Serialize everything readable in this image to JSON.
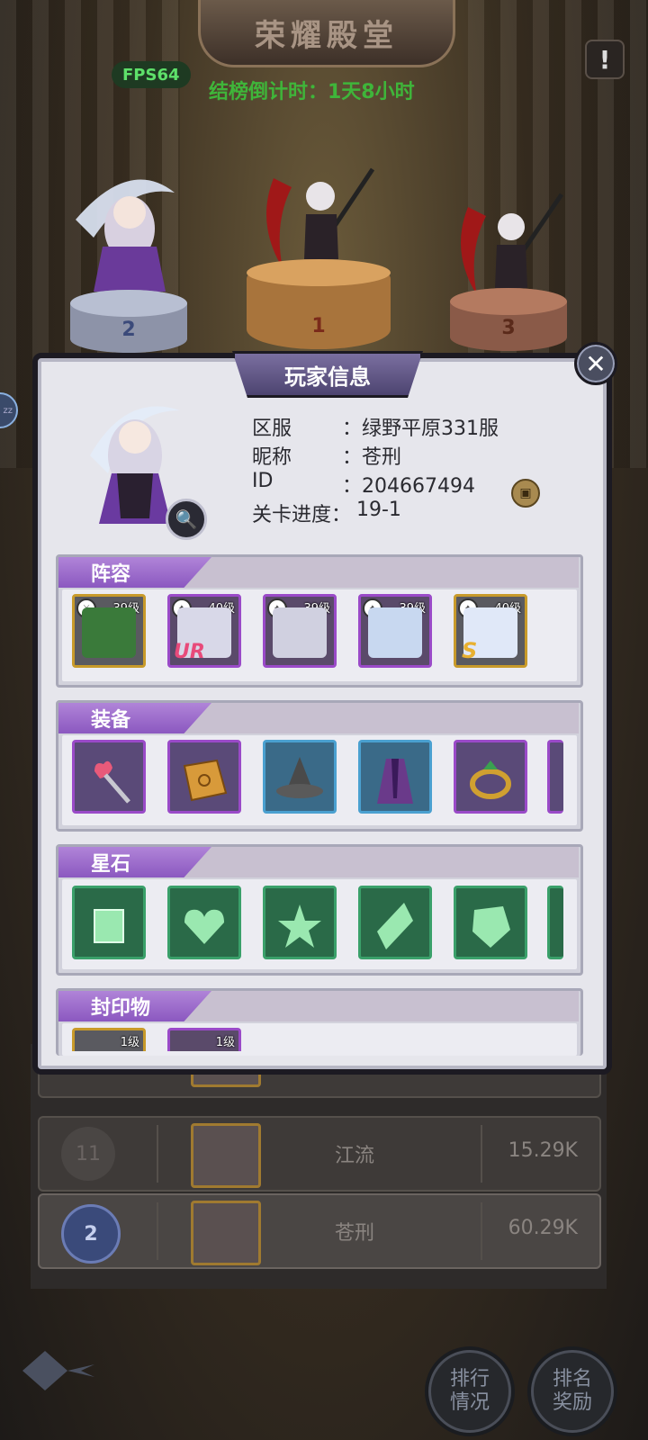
{
  "header": {
    "title": "荣耀殿堂",
    "fps": "FPS64",
    "countdown": "结榜倒计时：1天8小时",
    "info_icon": "!"
  },
  "podiums": [
    {
      "rank": "2"
    },
    {
      "rank": "1"
    },
    {
      "rank": "3"
    }
  ],
  "side_bubble": "zz",
  "modal": {
    "title": "玩家信息",
    "close_icon": "✕",
    "magnify_icon": "🔍",
    "info": [
      {
        "key": "区服",
        "value": "：绿野平原331服"
      },
      {
        "key": "昵称",
        "value": "：苍刑"
      },
      {
        "key": "ID",
        "value": "：204667494"
      },
      {
        "key": "关卡进度：",
        "value": "19-1"
      }
    ],
    "copy_icon": "▣",
    "sections": {
      "lineup": {
        "title": "阵容",
        "heroes": [
          {
            "level": "39级",
            "frame": "gold",
            "color": "#3a7a3a"
          },
          {
            "level": "40级",
            "frame": "purple",
            "color": "#d8d8e8",
            "tag": "UR"
          },
          {
            "level": "39级",
            "frame": "purple",
            "color": "#d0d0e0"
          },
          {
            "level": "39级",
            "frame": "purple",
            "color": "#c8d8f0"
          },
          {
            "level": "40级",
            "frame": "gold",
            "color": "#e0e8f8",
            "tag": "S"
          }
        ]
      },
      "equipment": {
        "title": "装备",
        "items": [
          {
            "name": "staff-icon",
            "frame": "purple",
            "color": "#e85a7a"
          },
          {
            "name": "book-icon",
            "frame": "purple",
            "color": "#d89a3a"
          },
          {
            "name": "hat-icon",
            "frame": "blue",
            "color": "#5a5a5a"
          },
          {
            "name": "robe-icon",
            "frame": "blue",
            "color": "#6a3a8a"
          },
          {
            "name": "ring-icon",
            "frame": "purple",
            "color": "#d0a030"
          }
        ]
      },
      "starstone": {
        "title": "星石",
        "gems": [
          {
            "name": "square-gem-icon"
          },
          {
            "name": "heart-gem-icon"
          },
          {
            "name": "star-gem-icon"
          },
          {
            "name": "diamond-gem-icon"
          },
          {
            "name": "round-gem-icon"
          }
        ]
      },
      "seal": {
        "title": "封印物",
        "items": [
          {
            "level": "1级"
          },
          {
            "level": "1级"
          }
        ]
      }
    }
  },
  "rank_list": [
    {
      "rank": "11",
      "name": "江流",
      "score": "15.29K"
    },
    {
      "rank": "2",
      "name": "苍刑",
      "score": "60.29K"
    }
  ],
  "bottom_nav": {
    "ranking_label": "排行\n情况",
    "reward_label": "排名\n奖励"
  },
  "colors": {
    "accent_purple": "#8b58c0",
    "gem_green": "#3aa06a",
    "gold_frame": "#c89a2a"
  }
}
